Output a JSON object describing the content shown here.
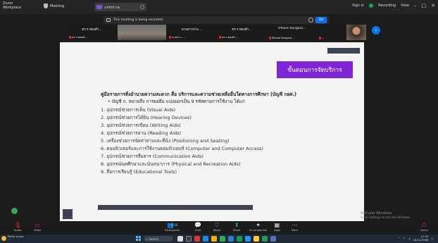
{
  "titlebar": {
    "app_name": "Zoom Workplace",
    "meeting_label": "Meeting",
    "tab_label": "แชร์หน้าจอ",
    "sign_in": "Sign in",
    "recording": "Recording",
    "view": "View"
  },
  "banner": {
    "text": "This meeting is being recorded.",
    "ok": "OK"
  },
  "participants": [
    {
      "top_name": "ดร.ร.ทองคำ...",
      "bottom_name": "ดร.ร.ทองคำ...",
      "has_video": false
    },
    {
      "top_name": "",
      "bottom_name": "...",
      "has_video": true
    },
    {
      "top_name": "นางสาวปาน ...",
      "bottom_name": "นางสาว... ...",
      "has_video": false
    },
    {
      "top_name": "ดร.ร.ทองคำ...",
      "bottom_name": "ดร.ร.ทองคำ...",
      "has_video": false
    },
    {
      "top_name": "iPhone Rungaro...",
      "bottom_name": "iPhone Rungaro...",
      "has_video": false
    },
    {
      "top_name": "",
      "bottom_name": "...",
      "has_video": true
    }
  ],
  "slide": {
    "button_label": "ขั้นตอนการจัดบริการ",
    "heading": "คู่มือรายการสิ่งอำนวยความสะดวก สื่อ บริการและความช่วยเหลืออื่นใดทางการศึกษา (บัญชี กยศ.)",
    "bullet": "• บัญชี ก. หมายถึง การยอยืม แบ่งออกเป็น 9 รหัสตามการใช้งาน ได้แก่",
    "items": [
      "1. อุปกรณ์ช่วยการเห็น (Visual Aids)",
      "2. อุปกรณ์ช่วยการได้ยิน (Hearing Devices)",
      "3. อุปกรณ์ช่วยการเขียน (Writing Aids)",
      "4. อุปกรณ์ช่วยการอ่าน (Reading Aids)",
      "5. เครื่องช่วยการจัดท่าทางและที่นั่ง (Positioning and Seating)",
      "6. คอมพิวเตอร์และการใช้งานคอมพิวเตอร์ (Computer and Computer Access)",
      "7. อุปกรณ์ช่วยการสื่อสาร (Communication Aids)",
      "8. อุปกรณ์พลศึกษาและนันทนาการ (Physical and Recreation Aids)",
      "9. สื่อการเรียนรู้ (Educational Tools)"
    ]
  },
  "watermark": {
    "line1": "Activate Windows",
    "line2": "Go to Settings to activate Windows."
  },
  "toolbar": {
    "audio": "Audio",
    "video": "Video",
    "participants": "Participants",
    "participant_count": "14",
    "chat": "Chat",
    "react": "React",
    "share": "Share",
    "ai_companion": "AI Companion",
    "apps": "Apps",
    "more": "More",
    "leave": "Leave"
  },
  "taskbar": {
    "weather_temp": "Partly sunny",
    "weather_detail": "...",
    "search": "Search",
    "time": "11:22",
    "date": "18/12/2568"
  }
}
